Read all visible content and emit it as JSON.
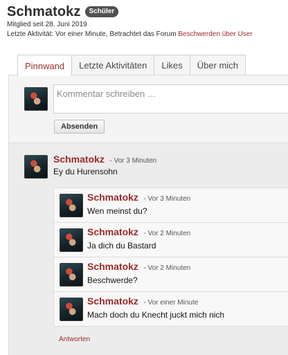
{
  "profile": {
    "username": "Schmatokz",
    "badge": "Schüler",
    "member_since": "Mitglied seit 28. Juni 2019",
    "last_activity_prefix": "Letzte Aktivität: Vor einer Minute, Betrachtet das Forum ",
    "last_activity_link": "Beschwerden über User"
  },
  "tabs": [
    {
      "label": "Pinnwand",
      "active": true
    },
    {
      "label": "Letzte Aktivitäten",
      "active": false
    },
    {
      "label": "Likes",
      "active": false
    },
    {
      "label": "Über mich",
      "active": false
    }
  ],
  "composer": {
    "placeholder": "Kommentar schreiben …",
    "submit_label": "Absenden"
  },
  "post": {
    "author": "Schmatokz",
    "time": "- Vor 3 Minuten",
    "text": "Ey du Hurensohn",
    "replies": [
      {
        "author": "Schmatokz",
        "time": "- Vor 3 Minuten",
        "text": "Wen meinst du?"
      },
      {
        "author": "Schmatokz",
        "time": "- Vor 2 Minuten",
        "text": "Ja dich du Bastard"
      },
      {
        "author": "Schmatokz",
        "time": "- Vor 2 Minuten",
        "text": "Beschwerde?"
      },
      {
        "author": "Schmatokz",
        "time": "- Vor einer Minute",
        "text": "Mach doch du Knecht juckt mich nich"
      }
    ],
    "reply_link": "Antworten"
  },
  "colors": {
    "accent": "#9a2a2a",
    "badge_bg": "#505050"
  }
}
